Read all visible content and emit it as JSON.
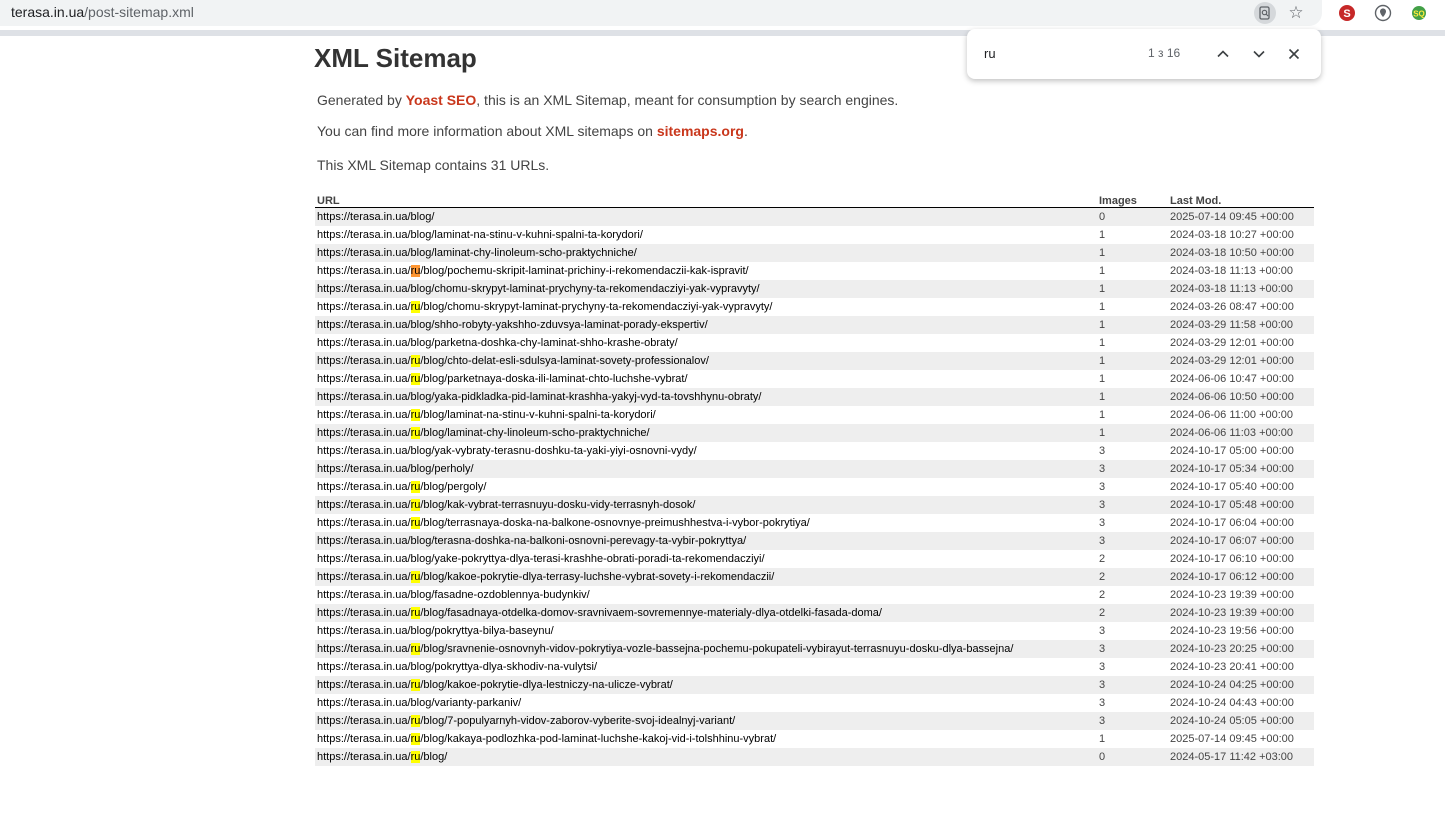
{
  "browser": {
    "url_host": "terasa.in.ua",
    "url_path": "/post-sitemap.xml",
    "find": {
      "query": "ru",
      "count": "1 з 16"
    }
  },
  "page": {
    "title": "XML Sitemap",
    "intro_prefix": "Generated by ",
    "intro_link": "Yoast SEO",
    "intro_suffix": ", this is an XML Sitemap, meant for consumption by search engines.",
    "info_prefix": "You can find more information about XML sitemaps on ",
    "info_link": "sitemaps.org",
    "info_suffix": ".",
    "count_text": "This XML Sitemap contains 31 URLs."
  },
  "table": {
    "headers": {
      "url": "URL",
      "images": "Images",
      "lastmod": "Last Mod."
    },
    "rows": [
      {
        "url": "https://terasa.in.ua/blog/",
        "images": "0",
        "lastmod": "2025-07-14 09:45 +00:00"
      },
      {
        "url": "https://terasa.in.ua/blog/laminat-na-stinu-v-kuhni-spalni-ta-korydori/",
        "images": "1",
        "lastmod": "2024-03-18 10:27 +00:00"
      },
      {
        "url": "https://terasa.in.ua/blog/laminat-chy-linoleum-scho-praktychniche/",
        "images": "1",
        "lastmod": "2024-03-18 10:50 +00:00"
      },
      {
        "url": "https://terasa.in.ua/ru/blog/pochemu-skripit-laminat-prichiny-i-rekomendaczii-kak-ispravit/",
        "images": "1",
        "lastmod": "2024-03-18 11:13 +00:00"
      },
      {
        "url": "https://terasa.in.ua/blog/chomu-skrypyt-laminat-prychyny-ta-rekomendacziyi-yak-vypravyty/",
        "images": "1",
        "lastmod": "2024-03-18 11:13 +00:00"
      },
      {
        "url": "https://terasa.in.ua/ru/blog/chomu-skrypyt-laminat-prychyny-ta-rekomendacziyi-yak-vypravyty/",
        "images": "1",
        "lastmod": "2024-03-26 08:47 +00:00"
      },
      {
        "url": "https://terasa.in.ua/blog/shho-robyty-yakshho-zduvsya-laminat-porady-ekspertiv/",
        "images": "1",
        "lastmod": "2024-03-29 11:58 +00:00"
      },
      {
        "url": "https://terasa.in.ua/blog/parketna-doshka-chy-laminat-shho-krashe-obraty/",
        "images": "1",
        "lastmod": "2024-03-29 12:01 +00:00"
      },
      {
        "url": "https://terasa.in.ua/ru/blog/chto-delat-esli-sdulsya-laminat-sovety-professionalov/",
        "images": "1",
        "lastmod": "2024-03-29 12:01 +00:00"
      },
      {
        "url": "https://terasa.in.ua/ru/blog/parketnaya-doska-ili-laminat-chto-luchshe-vybrat/",
        "images": "1",
        "lastmod": "2024-06-06 10:47 +00:00"
      },
      {
        "url": "https://terasa.in.ua/blog/yaka-pidkladka-pid-laminat-krashha-yakyj-vyd-ta-tovshhynu-obraty/",
        "images": "1",
        "lastmod": "2024-06-06 10:50 +00:00"
      },
      {
        "url": "https://terasa.in.ua/ru/blog/laminat-na-stinu-v-kuhni-spalni-ta-korydori/",
        "images": "1",
        "lastmod": "2024-06-06 11:00 +00:00"
      },
      {
        "url": "https://terasa.in.ua/ru/blog/laminat-chy-linoleum-scho-praktychniche/",
        "images": "1",
        "lastmod": "2024-06-06 11:03 +00:00"
      },
      {
        "url": "https://terasa.in.ua/blog/yak-vybraty-terasnu-doshku-ta-yaki-yiyi-osnovni-vydy/",
        "images": "3",
        "lastmod": "2024-10-17 05:00 +00:00"
      },
      {
        "url": "https://terasa.in.ua/blog/perholy/",
        "images": "3",
        "lastmod": "2024-10-17 05:34 +00:00"
      },
      {
        "url": "https://terasa.in.ua/ru/blog/pergoly/",
        "images": "3",
        "lastmod": "2024-10-17 05:40 +00:00"
      },
      {
        "url": "https://terasa.in.ua/ru/blog/kak-vybrat-terrasnuyu-dosku-vidy-terrasnyh-dosok/",
        "images": "3",
        "lastmod": "2024-10-17 05:48 +00:00"
      },
      {
        "url": "https://terasa.in.ua/ru/blog/terrasnaya-doska-na-balkone-osnovnye-preimushhestva-i-vybor-pokrytiya/",
        "images": "3",
        "lastmod": "2024-10-17 06:04 +00:00"
      },
      {
        "url": "https://terasa.in.ua/blog/terasna-doshka-na-balkoni-osnovni-perevagy-ta-vybir-pokryttya/",
        "images": "3",
        "lastmod": "2024-10-17 06:07 +00:00"
      },
      {
        "url": "https://terasa.in.ua/blog/yake-pokryttya-dlya-terasi-krashhe-obrati-poradi-ta-rekomendacziyi/",
        "images": "2",
        "lastmod": "2024-10-17 06:10 +00:00"
      },
      {
        "url": "https://terasa.in.ua/ru/blog/kakoe-pokrytie-dlya-terrasy-luchshe-vybrat-sovety-i-rekomendaczii/",
        "images": "2",
        "lastmod": "2024-10-17 06:12 +00:00"
      },
      {
        "url": "https://terasa.in.ua/blog/fasadne-ozdoblennya-budynkiv/",
        "images": "2",
        "lastmod": "2024-10-23 19:39 +00:00"
      },
      {
        "url": "https://terasa.in.ua/ru/blog/fasadnaya-otdelka-domov-sravnivaem-sovremennye-materialy-dlya-otdelki-fasada-doma/",
        "images": "2",
        "lastmod": "2024-10-23 19:39 +00:00"
      },
      {
        "url": "https://terasa.in.ua/blog/pokryttya-bilya-baseynu/",
        "images": "3",
        "lastmod": "2024-10-23 19:56 +00:00"
      },
      {
        "url": "https://terasa.in.ua/ru/blog/sravnenie-osnovnyh-vidov-pokrytiya-vozle-bassejna-pochemu-pokupateli-vybirayut-terrasnuyu-dosku-dlya-bassejna/",
        "images": "3",
        "lastmod": "2024-10-23 20:25 +00:00"
      },
      {
        "url": "https://terasa.in.ua/blog/pokryttya-dlya-skhodiv-na-vulytsi/",
        "images": "3",
        "lastmod": "2024-10-23 20:41 +00:00"
      },
      {
        "url": "https://terasa.in.ua/ru/blog/kakoe-pokrytie-dlya-lestniczy-na-ulicze-vybrat/",
        "images": "3",
        "lastmod": "2024-10-24 04:25 +00:00"
      },
      {
        "url": "https://terasa.in.ua/blog/varianty-parkaniv/",
        "images": "3",
        "lastmod": "2024-10-24 04:43 +00:00"
      },
      {
        "url": "https://terasa.in.ua/ru/blog/7-populyarnyh-vidov-zaborov-vyberite-svoj-idealnyj-variant/",
        "images": "3",
        "lastmod": "2024-10-24 05:05 +00:00"
      },
      {
        "url": "https://terasa.in.ua/ru/blog/kakaya-podlozhka-pod-laminat-luchshe-kakoj-vid-i-tolshhinu-vybrat/",
        "images": "1",
        "lastmod": "2025-07-14 09:45 +00:00"
      },
      {
        "url": "https://terasa.in.ua/ru/blog/",
        "images": "0",
        "lastmod": "2024-05-17 11:42 +03:00"
      }
    ]
  }
}
